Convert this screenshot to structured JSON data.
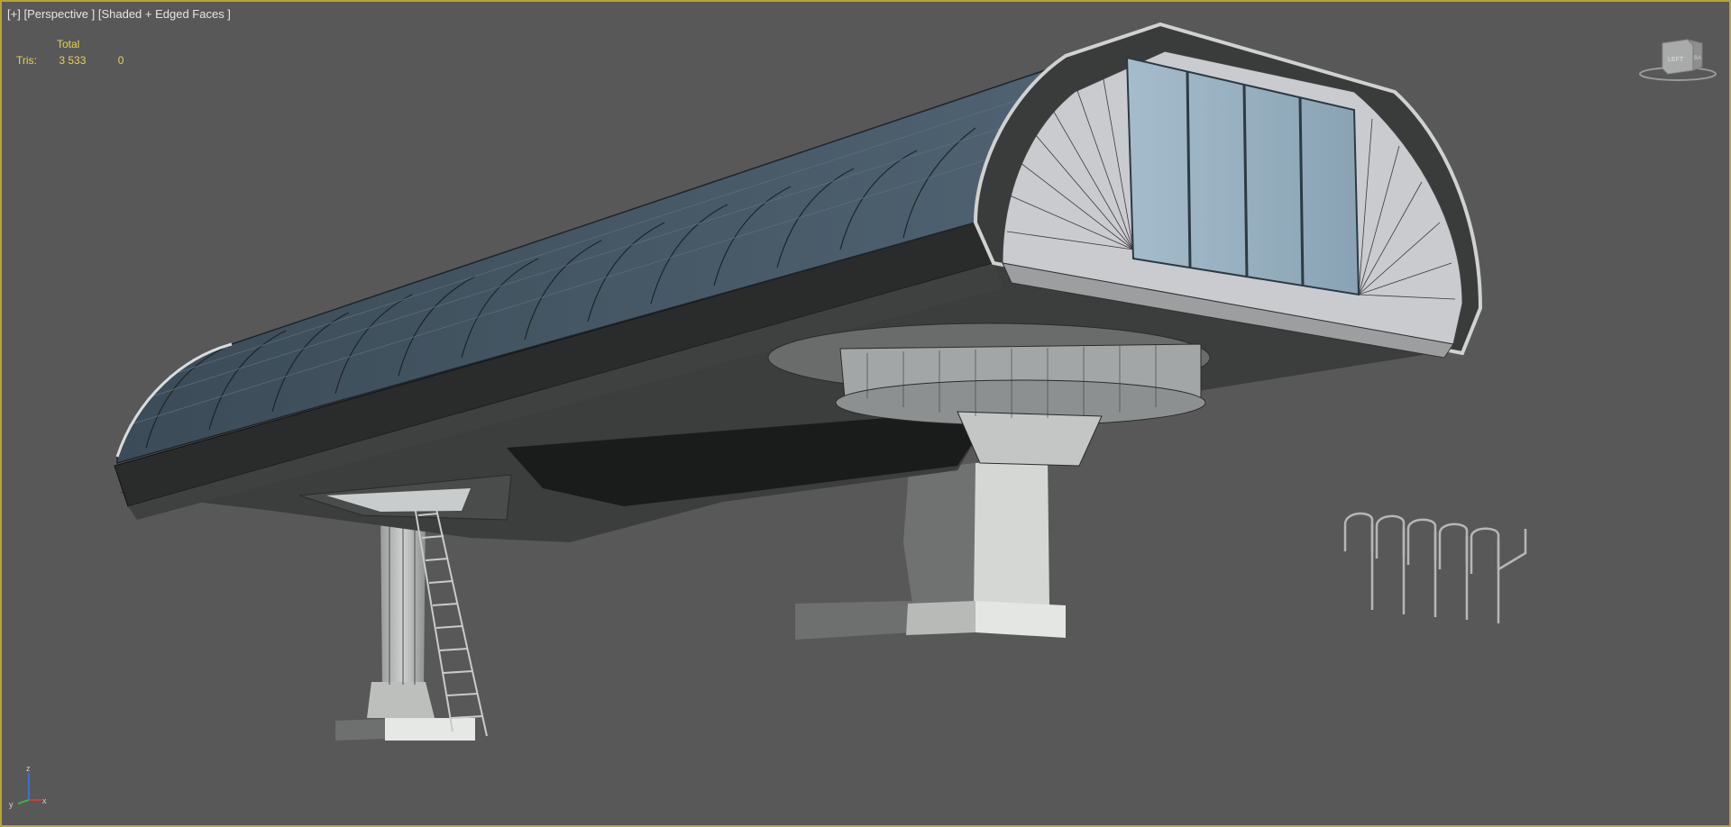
{
  "viewport": {
    "menu_plus": "[+]",
    "menu_view": "[Perspective ]",
    "menu_shading": "[Shaded + Edged Faces ]"
  },
  "stats": {
    "header": "Total",
    "row_label": "Tris:",
    "total_value": "3 533",
    "selected_value": "0"
  },
  "viewcube": {
    "face_label": "LEFT",
    "side_label": "BA"
  },
  "axis_gizmo": {
    "z": "z",
    "x": "x",
    "y": "y"
  },
  "colors": {
    "viewport_border": "#b9a23e",
    "background": "#585858",
    "stats_text": "#e8d34a",
    "label_text": "#e6e6e6"
  }
}
